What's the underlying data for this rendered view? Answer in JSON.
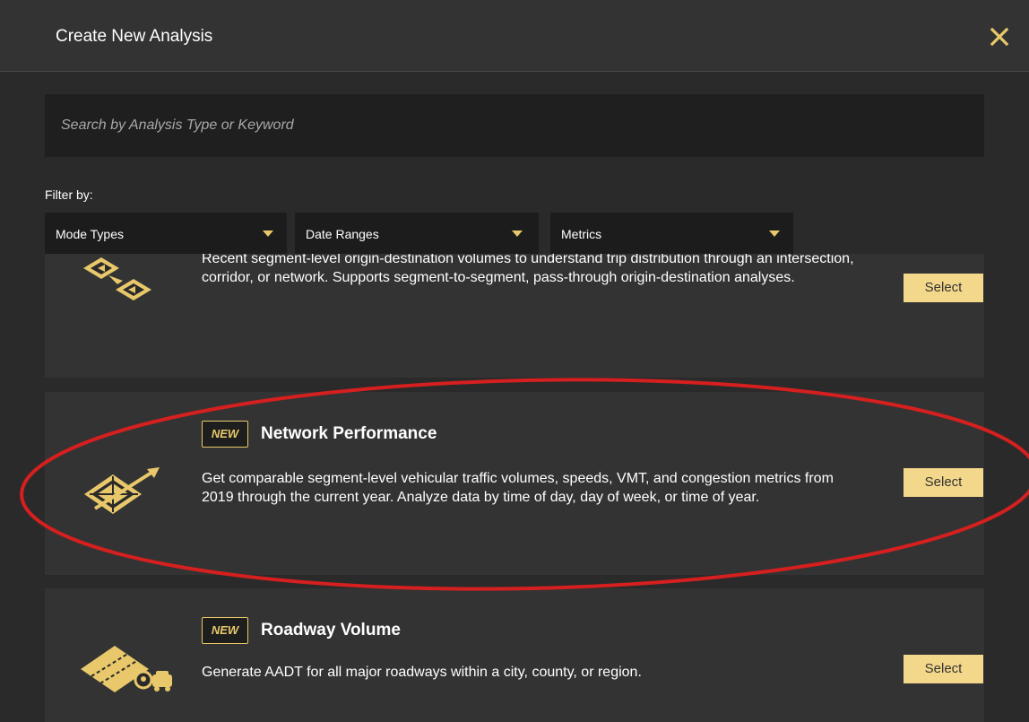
{
  "modal": {
    "title": "Create New Analysis",
    "close_icon": "close-icon"
  },
  "search": {
    "placeholder": "Search by Analysis Type or Keyword"
  },
  "filters": {
    "label": "Filter by:",
    "mode_types": "Mode Types",
    "date_ranges": "Date Ranges",
    "metrics": "Metrics"
  },
  "analyses": [
    {
      "title": "",
      "badge": "",
      "icon": "origin-destination-icon",
      "description": "Recent segment-level origin-destination volumes to understand trip distribution through an intersection, corridor, or network. Supports segment-to-segment, pass-through origin-destination analyses.",
      "select_label": "Select"
    },
    {
      "title": "Network Performance",
      "badge": "NEW",
      "icon": "network-performance-icon",
      "description": "Get comparable segment-level vehicular traffic volumes, speeds, VMT, and congestion metrics from 2019 through the current year. Analyze data by time of day, day of week, or time of year.",
      "select_label": "Select"
    },
    {
      "title": "Roadway Volume",
      "badge": "NEW",
      "icon": "roadway-volume-icon",
      "description": "Generate AADT for all major roadways within a city, county, or region.",
      "select_label": "Select"
    }
  ],
  "colors": {
    "accent": "#e8c86a",
    "button": "#f3d78a",
    "highlight": "#d61f1f",
    "background": "#2a2a2a",
    "card": "#333333"
  }
}
